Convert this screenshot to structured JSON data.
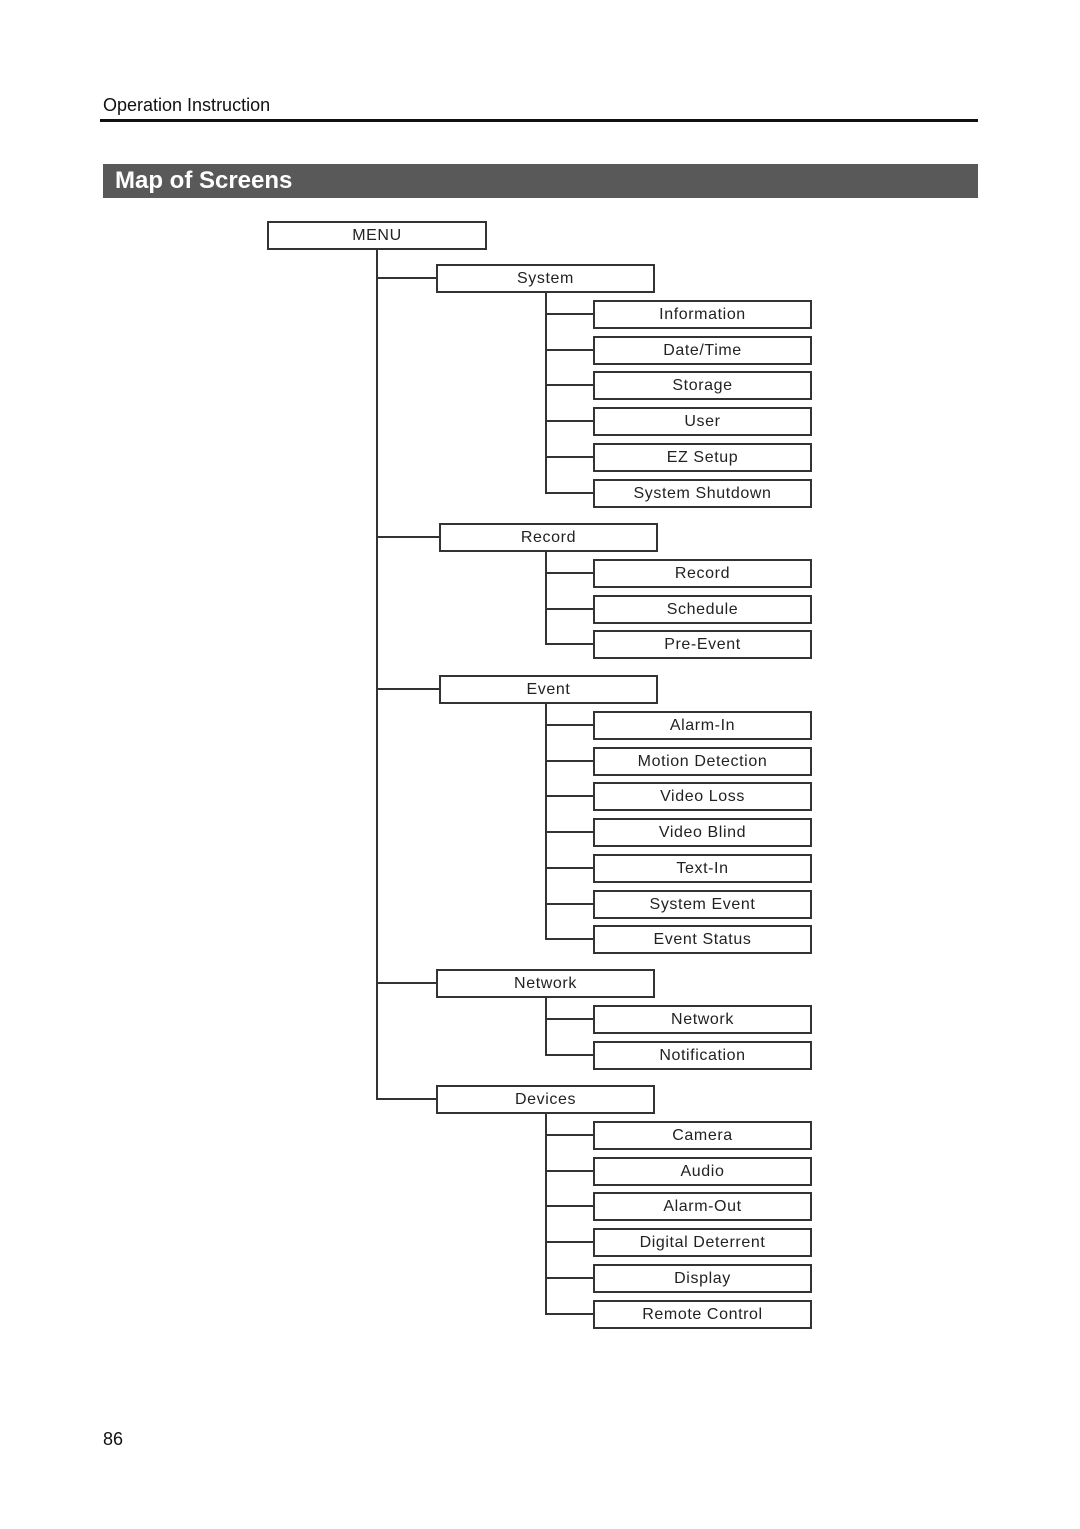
{
  "page": {
    "header": "Operation Instruction",
    "title": "Map of Screens",
    "page_number": "86"
  },
  "tree": {
    "root": "MENU",
    "groups": [
      {
        "label": "System",
        "children": [
          "Information",
          "Date/Time",
          "Storage",
          "User",
          "EZ Setup",
          "System Shutdown"
        ]
      },
      {
        "label": "Record",
        "children": [
          "Record",
          "Schedule",
          "Pre-Event"
        ]
      },
      {
        "label": "Event",
        "children": [
          "Alarm-In",
          "Motion Detection",
          "Video Loss",
          "Video Blind",
          "Text-In",
          "System Event",
          "Event Status"
        ]
      },
      {
        "label": "Network",
        "children": [
          "Network",
          "Notification"
        ]
      },
      {
        "label": "Devices",
        "children": [
          "Camera",
          "Audio",
          "Alarm-Out",
          "Digital Deterrent",
          "Display",
          "Remote Control"
        ]
      }
    ]
  }
}
